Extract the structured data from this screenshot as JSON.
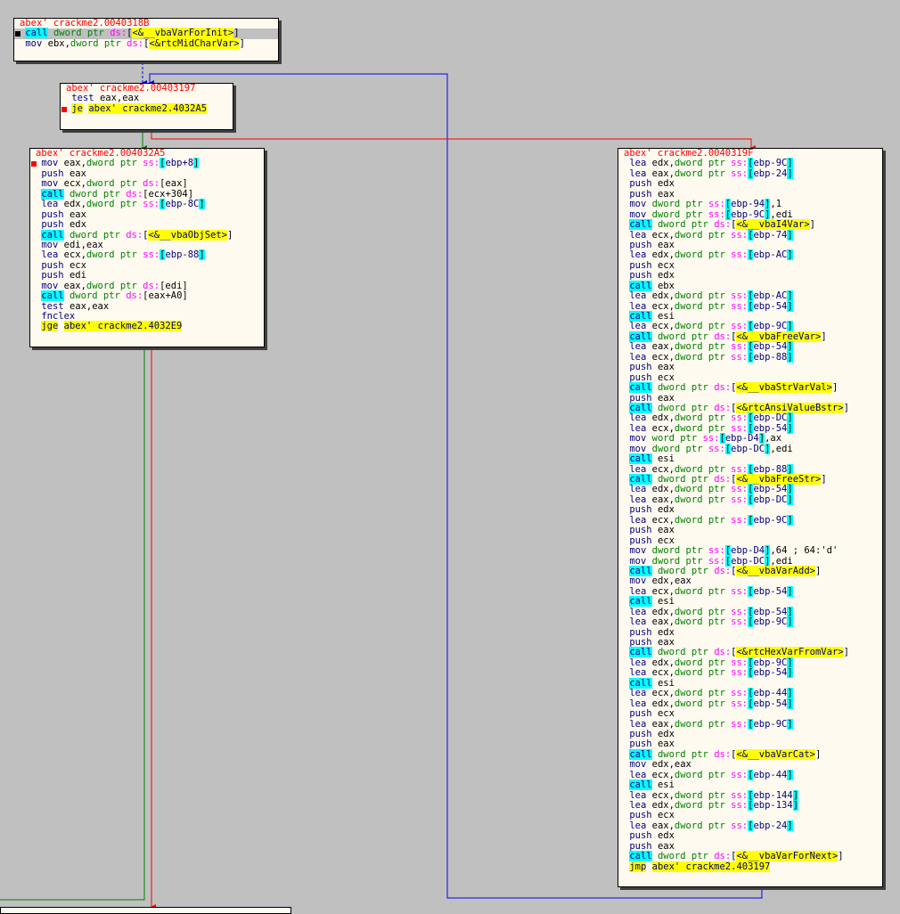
{
  "graph": {
    "blocks": [
      {
        "id": "b1",
        "header": "abex' crackme2.0040318B",
        "lines": [
          {
            "text": "call dword ptr ds:[<&__vbaVarForInit>]",
            "bp": "black",
            "sel": true
          },
          {
            "text": "mov ebx,dword ptr ds:[<&rtcMidCharVar>]"
          }
        ]
      },
      {
        "id": "b2",
        "header": "abex' crackme2.00403197",
        "lines": [
          {
            "text": "test eax,eax"
          },
          {
            "text": "je abex' crackme2.4032A5",
            "bp": "red"
          }
        ]
      },
      {
        "id": "b3",
        "header": "abex' crackme2.004032A5",
        "lines": [
          {
            "text": "mov eax,dword ptr ss:[ebp+8]",
            "bp": "red"
          },
          {
            "text": "push eax"
          },
          {
            "text": "mov ecx,dword ptr ds:[eax]"
          },
          {
            "text": "call dword ptr ds:[ecx+304]"
          },
          {
            "text": "lea edx,dword ptr ss:[ebp-8C]"
          },
          {
            "text": "push eax"
          },
          {
            "text": "push edx"
          },
          {
            "text": "call dword ptr ds:[<&__vbaObjSet>]"
          },
          {
            "text": "mov edi,eax"
          },
          {
            "text": "lea ecx,dword ptr ss:[ebp-88]"
          },
          {
            "text": "push ecx"
          },
          {
            "text": "push edi"
          },
          {
            "text": "mov eax,dword ptr ds:[edi]"
          },
          {
            "text": "call dword ptr ds:[eax+A0]"
          },
          {
            "text": "test eax,eax"
          },
          {
            "text": "fnclex"
          },
          {
            "text": "jge abex' crackme2.4032E9"
          }
        ]
      },
      {
        "id": "b4",
        "header": "abex' crackme2.0040319F",
        "lines": [
          {
            "text": "lea edx,dword ptr ss:[ebp-9C]"
          },
          {
            "text": "lea eax,dword ptr ss:[ebp-24]"
          },
          {
            "text": "push edx"
          },
          {
            "text": "push eax"
          },
          {
            "text": "mov dword ptr ss:[ebp-94],1"
          },
          {
            "text": "mov dword ptr ss:[ebp-9C],edi"
          },
          {
            "text": "call dword ptr ds:[<&__vbaI4Var>]"
          },
          {
            "text": "lea ecx,dword ptr ss:[ebp-74]"
          },
          {
            "text": "push eax"
          },
          {
            "text": "lea edx,dword ptr ss:[ebp-AC]"
          },
          {
            "text": "push ecx"
          },
          {
            "text": "push edx"
          },
          {
            "text": "call ebx"
          },
          {
            "text": "lea edx,dword ptr ss:[ebp-AC]"
          },
          {
            "text": "lea ecx,dword ptr ss:[ebp-54]"
          },
          {
            "text": "call esi"
          },
          {
            "text": "lea ecx,dword ptr ss:[ebp-9C]"
          },
          {
            "text": "call dword ptr ds:[<&__vbaFreeVar>]"
          },
          {
            "text": "lea eax,dword ptr ss:[ebp-54]"
          },
          {
            "text": "lea ecx,dword ptr ss:[ebp-88]"
          },
          {
            "text": "push eax"
          },
          {
            "text": "push ecx"
          },
          {
            "text": "call dword ptr ds:[<&__vbaStrVarVal>]"
          },
          {
            "text": "push eax"
          },
          {
            "text": "call dword ptr ds:[<&rtcAnsiValueBstr>]"
          },
          {
            "text": "lea edx,dword ptr ss:[ebp-DC]"
          },
          {
            "text": "lea ecx,dword ptr ss:[ebp-54]"
          },
          {
            "text": "mov word ptr ss:[ebp-D4],ax"
          },
          {
            "text": "mov dword ptr ss:[ebp-DC],edi"
          },
          {
            "text": "call esi"
          },
          {
            "text": "lea ecx,dword ptr ss:[ebp-88]"
          },
          {
            "text": "call dword ptr ds:[<&__vbaFreeStr>]"
          },
          {
            "text": "lea edx,dword ptr ss:[ebp-54]"
          },
          {
            "text": "lea eax,dword ptr ss:[ebp-DC]"
          },
          {
            "text": "push edx"
          },
          {
            "text": "lea ecx,dword ptr ss:[ebp-9C]"
          },
          {
            "text": "push eax"
          },
          {
            "text": "push ecx"
          },
          {
            "text": "mov dword ptr ss:[ebp-D4],64 ; 64:'d'"
          },
          {
            "text": "mov dword ptr ss:[ebp-DC],edi"
          },
          {
            "text": "call dword ptr ds:[<&__vbaVarAdd>]"
          },
          {
            "text": "mov edx,eax"
          },
          {
            "text": "lea ecx,dword ptr ss:[ebp-54]"
          },
          {
            "text": "call esi"
          },
          {
            "text": "lea edx,dword ptr ss:[ebp-54]"
          },
          {
            "text": "lea eax,dword ptr ss:[ebp-9C]"
          },
          {
            "text": "push edx"
          },
          {
            "text": "push eax"
          },
          {
            "text": "call dword ptr ds:[<&rtcHexVarFromVar>]"
          },
          {
            "text": "lea edx,dword ptr ss:[ebp-9C]"
          },
          {
            "text": "lea ecx,dword ptr ss:[ebp-54]"
          },
          {
            "text": "call esi"
          },
          {
            "text": "lea ecx,dword ptr ss:[ebp-44]"
          },
          {
            "text": "lea edx,dword ptr ss:[ebp-54]"
          },
          {
            "text": "push ecx"
          },
          {
            "text": "lea eax,dword ptr ss:[ebp-9C]"
          },
          {
            "text": "push edx"
          },
          {
            "text": "push eax"
          },
          {
            "text": "call dword ptr ds:[<&__vbaVarCat>]"
          },
          {
            "text": "mov edx,eax"
          },
          {
            "text": "lea ecx,dword ptr ss:[ebp-44]"
          },
          {
            "text": "call esi"
          },
          {
            "text": "lea ecx,dword ptr ss:[ebp-144]"
          },
          {
            "text": "lea edx,dword ptr ss:[ebp-134]"
          },
          {
            "text": "push ecx"
          },
          {
            "text": "lea eax,dword ptr ss:[ebp-24]"
          },
          {
            "text": "push edx"
          },
          {
            "text": "push eax"
          },
          {
            "text": "call dword ptr ds:[<&__vbaVarForNext>]"
          },
          {
            "text": "jmp abex' crackme2.403197"
          }
        ]
      }
    ]
  },
  "colors": {
    "background": "#c0c0c0",
    "block_bg": "#fffaf0",
    "header": "#ff0000",
    "edge_true": "#008000",
    "edge_false": "#ff0000",
    "edge_jump": "#0000ff"
  }
}
